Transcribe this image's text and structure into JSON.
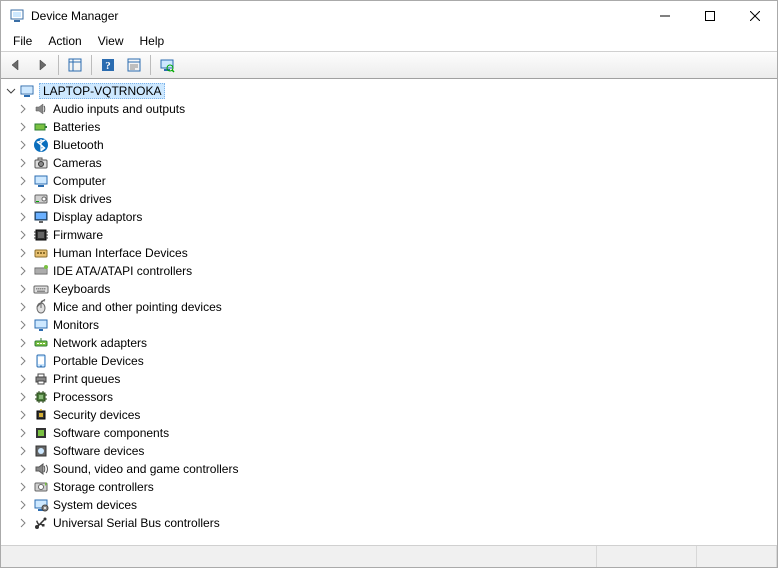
{
  "window": {
    "title": "Device Manager"
  },
  "menu": {
    "file": "File",
    "action": "Action",
    "view": "View",
    "help": "Help"
  },
  "tree": {
    "root": "LAPTOP-VQTRNOKA",
    "items": [
      {
        "label": "Audio inputs and outputs",
        "icon": "speaker"
      },
      {
        "label": "Batteries",
        "icon": "battery"
      },
      {
        "label": "Bluetooth",
        "icon": "bluetooth"
      },
      {
        "label": "Cameras",
        "icon": "camera"
      },
      {
        "label": "Computer",
        "icon": "computer"
      },
      {
        "label": "Disk drives",
        "icon": "disk"
      },
      {
        "label": "Display adaptors",
        "icon": "display"
      },
      {
        "label": "Firmware",
        "icon": "firmware"
      },
      {
        "label": "Human Interface Devices",
        "icon": "hid"
      },
      {
        "label": "IDE ATA/ATAPI controllers",
        "icon": "ide"
      },
      {
        "label": "Keyboards",
        "icon": "keyboard"
      },
      {
        "label": "Mice and other pointing devices",
        "icon": "mouse"
      },
      {
        "label": "Monitors",
        "icon": "monitor"
      },
      {
        "label": "Network adapters",
        "icon": "network"
      },
      {
        "label": "Portable Devices",
        "icon": "portable"
      },
      {
        "label": "Print queues",
        "icon": "printer"
      },
      {
        "label": "Processors",
        "icon": "cpu"
      },
      {
        "label": "Security devices",
        "icon": "security"
      },
      {
        "label": "Software components",
        "icon": "swcomp"
      },
      {
        "label": "Software devices",
        "icon": "swdev"
      },
      {
        "label": "Sound, video and game controllers",
        "icon": "sound"
      },
      {
        "label": "Storage controllers",
        "icon": "storage"
      },
      {
        "label": "System devices",
        "icon": "system"
      },
      {
        "label": "Universal Serial Bus controllers",
        "icon": "usb"
      }
    ]
  }
}
